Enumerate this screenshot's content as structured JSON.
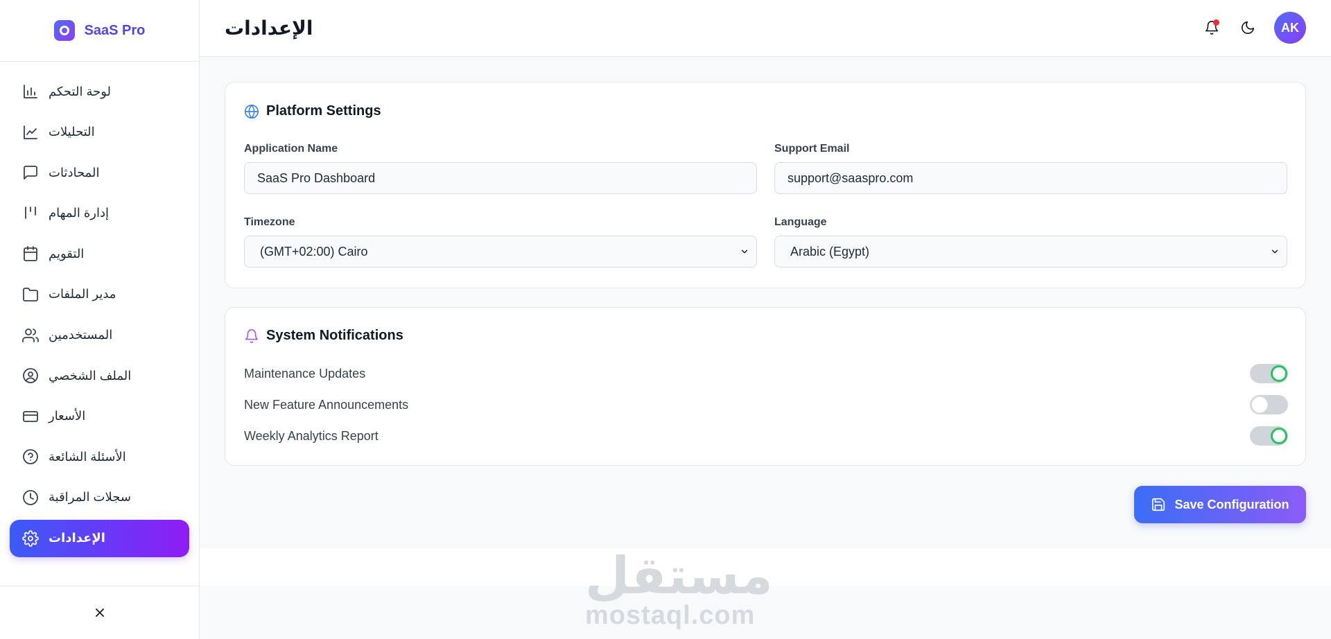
{
  "brand": {
    "name": "SaaS Pro"
  },
  "sidebar": {
    "items": [
      {
        "label": "لوحة التحكم",
        "icon": "bar-chart-icon",
        "active": false
      },
      {
        "label": "التحليلات",
        "icon": "line-chart-icon",
        "active": false
      },
      {
        "label": "المحادثات",
        "icon": "chat-icon",
        "active": false
      },
      {
        "label": "إدارة المهام",
        "icon": "kanban-icon",
        "active": false
      },
      {
        "label": "التقويم",
        "icon": "calendar-icon",
        "active": false
      },
      {
        "label": "مدير الملفات",
        "icon": "folder-icon",
        "active": false
      },
      {
        "label": "المستخدمين",
        "icon": "users-icon",
        "active": false
      },
      {
        "label": "الملف الشخصي",
        "icon": "user-circle-icon",
        "active": false
      },
      {
        "label": "الأسعار",
        "icon": "credit-card-icon",
        "active": false
      },
      {
        "label": "الأسئلة الشائعة",
        "icon": "help-circle-icon",
        "active": false
      },
      {
        "label": "سجلات المراقبة",
        "icon": "clock-icon",
        "active": false
      },
      {
        "label": "الإعدادات",
        "icon": "gear-icon",
        "active": true
      }
    ]
  },
  "header": {
    "title": "الإعدادات",
    "avatar_initials": "AK"
  },
  "platform_settings": {
    "title": "Platform Settings",
    "app_name_label": "Application Name",
    "app_name_value": "SaaS Pro Dashboard",
    "support_email_label": "Support Email",
    "support_email_value": "support@saaspro.com",
    "timezone_label": "Timezone",
    "timezone_value": "(GMT+02:00) Cairo",
    "language_label": "Language",
    "language_value": "Arabic (Egypt)"
  },
  "system_notifications": {
    "title": "System Notifications",
    "toggles": [
      {
        "label": "Maintenance Updates",
        "on": true
      },
      {
        "label": "New Feature Announcements",
        "on": false
      },
      {
        "label": "Weekly Analytics Report",
        "on": true
      }
    ]
  },
  "actions": {
    "save_label": "Save Configuration"
  },
  "watermark": {
    "arabic": "مستقل",
    "latin": "mostaql.com"
  },
  "colors": {
    "accent_start": "#3b5bf6",
    "accent_end": "#8f1cf6",
    "toggle_on": "#22c55e",
    "notification_dot": "#ef2b2b"
  }
}
